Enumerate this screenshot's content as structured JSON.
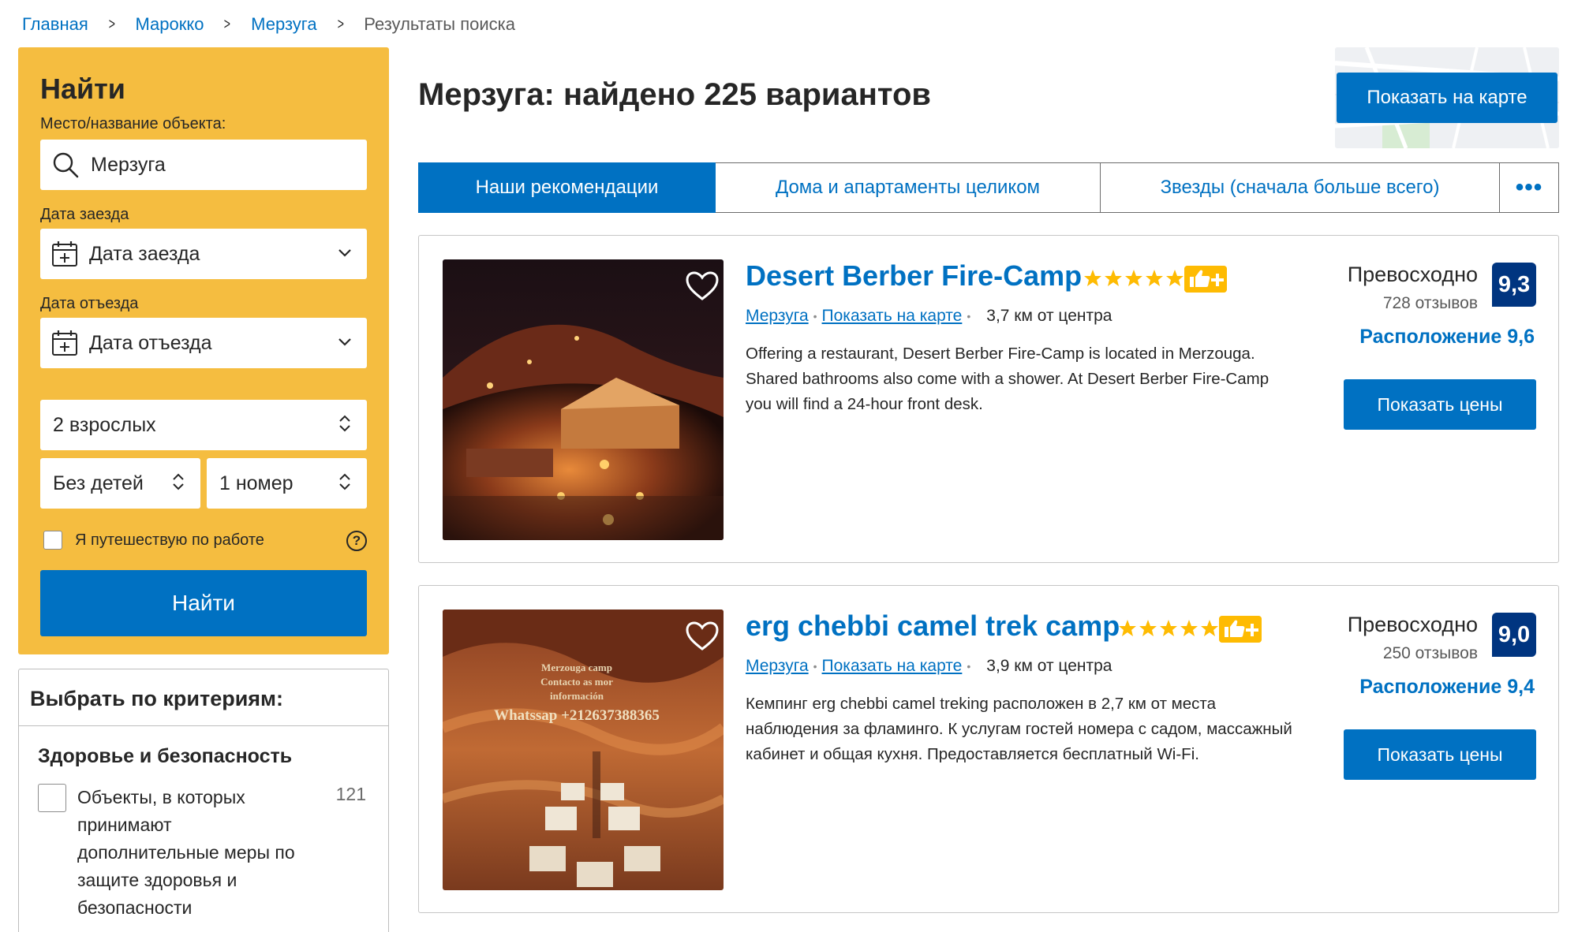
{
  "breadcrumb": {
    "items": [
      "Главная",
      "Марокко",
      "Мерзуга"
    ],
    "current": "Результаты поиска"
  },
  "search": {
    "title": "Найти",
    "destination_label": "Место/название объекта:",
    "destination_value": "Мерзуга",
    "checkin_label": "Дата заезда",
    "checkin_value": "Дата заезда",
    "checkout_label": "Дата отъезда",
    "checkout_value": "Дата отъезда",
    "adults": "2 взрослых",
    "children": "Без детей",
    "rooms": "1 номер",
    "work_travel": "Я путешествую по работе",
    "help": "?",
    "button": "Найти"
  },
  "filters": {
    "title": "Выбрать по критериям:",
    "group_title": "Здоровье и безопасность",
    "item_label": "Объекты, в которых принимают дополнительные меры по защите здоровья и безопасности",
    "item_count": "121"
  },
  "results": {
    "title": "Мерзуга: найдено 225 вариантов",
    "map_button": "Показать на карте"
  },
  "sort_tabs": [
    {
      "label": "Наши рекомендации",
      "active": true
    },
    {
      "label": "Дома и апартаменты целиком",
      "active": false
    },
    {
      "label": "Звезды (сначала больше всего)",
      "active": false
    },
    {
      "label": "•••",
      "active": false
    }
  ],
  "hotels": [
    {
      "name": "Desert Berber Fire-Camp",
      "stars": 5,
      "location": "Мерзуга",
      "show_on_map": "Показать на карте",
      "distance": "3,7 км от центра",
      "description": "Offering a restaurant, Desert Berber Fire-Camp is located in Merzouga. Shared bathrooms also come with a shower. At Desert Berber Fire-Camp you will find a 24-hour front desk.",
      "review_word": "Превосходно",
      "review_count": "728 отзывов",
      "score": "9,3",
      "location_score": "Расположение 9,6",
      "price_button": "Показать цены"
    },
    {
      "name": "erg chebbi camel trek camp",
      "stars": 5,
      "location": "Мерзуга",
      "show_on_map": "Показать на карте",
      "distance": "3,9 км от центра",
      "description": "Кемпинг erg chebbi camel treking расположен в 2,7 км от места наблюдения за фламинго. К услугам гостей номера с садом, массажный кабинет и общая кухня. Предоставляется бесплатный Wi-Fi.",
      "review_word": "Превосходно",
      "review_count": "250 отзывов",
      "score": "9,0",
      "location_score": "Расположение 9,4",
      "price_button": "Показать цены",
      "photo_text": [
        "Merzouga camp",
        "Contacto as mor",
        "información",
        "Whatssap +212637388365"
      ]
    }
  ],
  "colors": {
    "accent": "#0071c2",
    "search_bg": "#f5bd40",
    "score_bg": "#003580",
    "star": "#febb02"
  }
}
